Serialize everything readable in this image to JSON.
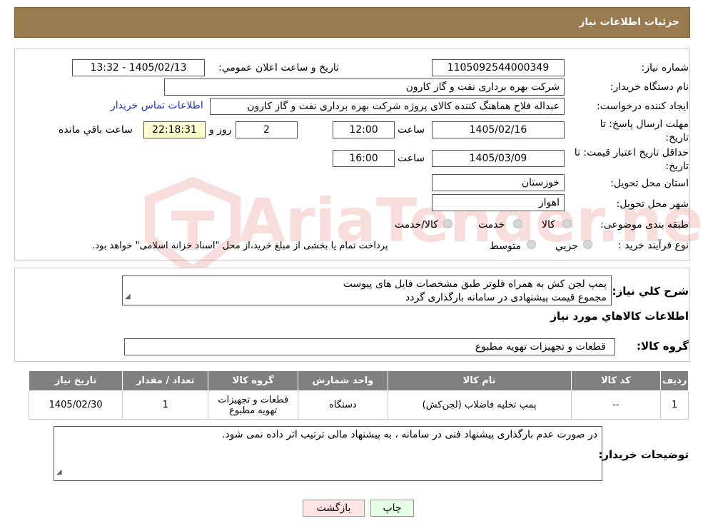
{
  "header": {
    "title": "جزئیات اطلاعات نیاز"
  },
  "fields": {
    "need_number_label": "شماره نیاز:",
    "need_number": "1105092544000349",
    "announce_label": "تاریخ و ساعت اعلان عمومي:",
    "announce_value": "1405/02/13 - 13:32",
    "buyer_org_label": "نام دستگاه خريدار:",
    "buyer_org": "شرکت بهره برداری نفت و گاز کارون",
    "creator_label": "ايجاد کننده درخواست:",
    "creator": "عبداله فلاح هماهنگ کننده کالای پروژه شرکت بهره برداری نفت و گاز کارون",
    "contact_link": "اطلاعات تماس خريدار",
    "deadline_label": "مهلت ارسال پاسخ: تا تاريخ:",
    "deadline_date": "1405/02/16",
    "time_label": "ساعت",
    "deadline_time": "12:00",
    "days_count": "2",
    "days_label": "روز و",
    "remaining": "22:18:31",
    "remaining_label": "ساعت باقي مانده",
    "price_valid_label": "حداقل تاريخ اعتبار قيمت: تا تاريخ:",
    "price_valid_date": "1405/03/09",
    "price_valid_time": "16:00",
    "province_label": "استان محل تحويل:",
    "province": "خوزستان",
    "city_label": "شهر محل تحويل:",
    "city": "اهواز",
    "category_label": "طبقه بندی موضوعی:",
    "category_options": [
      "کالا",
      "خدمت",
      "کالا/خدمت"
    ],
    "process_label": "نوع فرآيند خريد :",
    "process_options": [
      "جزيي",
      "متوسط"
    ],
    "process_note": "پرداخت تمام يا بخشی از مبلغ خريد،از محل \"اسناد خزانه اسلامی\" خواهد بود."
  },
  "description": {
    "label": "شرح کلي نياز:",
    "line1": "پمپ لجن کش به همراه فلوتر طبق مشخصات فایل های پیوست",
    "line2": "مجموع قیمت پیشنهادی در سامانه بارگذاری گردد"
  },
  "goods": {
    "section_title": "اطلاعات کالاهاي مورد نياز",
    "group_label": "گروه کالا:",
    "group_value": "قطعات و تجهیزات تهویه مطبوع"
  },
  "table": {
    "headers": [
      "رديف",
      "کد کالا",
      "نام کالا",
      "واحد شمارش",
      "گروه کالا",
      "تعداد / مقدار",
      "تاريخ نياز"
    ],
    "row": [
      "1",
      "--",
      "پمپ تخلیه فاضلاب (لجن‌کش)",
      "دستگاه",
      "قطعات و تجهیزات تهویه مطبوع",
      "1",
      "1405/02/30"
    ]
  },
  "buyer_notes": {
    "label": "توضيحات خريدار:",
    "text": "در صورت عدم بارگذاری پیشنهاد فنی در سامانه ، به پیشنهاد مالی ترتیب اثر داده نمی شود."
  },
  "buttons": {
    "back": "بازگشت",
    "print": "چاپ"
  },
  "watermark": "AriaTender.neT",
  "colors": {
    "header": "#9a7b4f",
    "back_button": "#ffe4e4",
    "print_button": "#e4ffe4"
  }
}
